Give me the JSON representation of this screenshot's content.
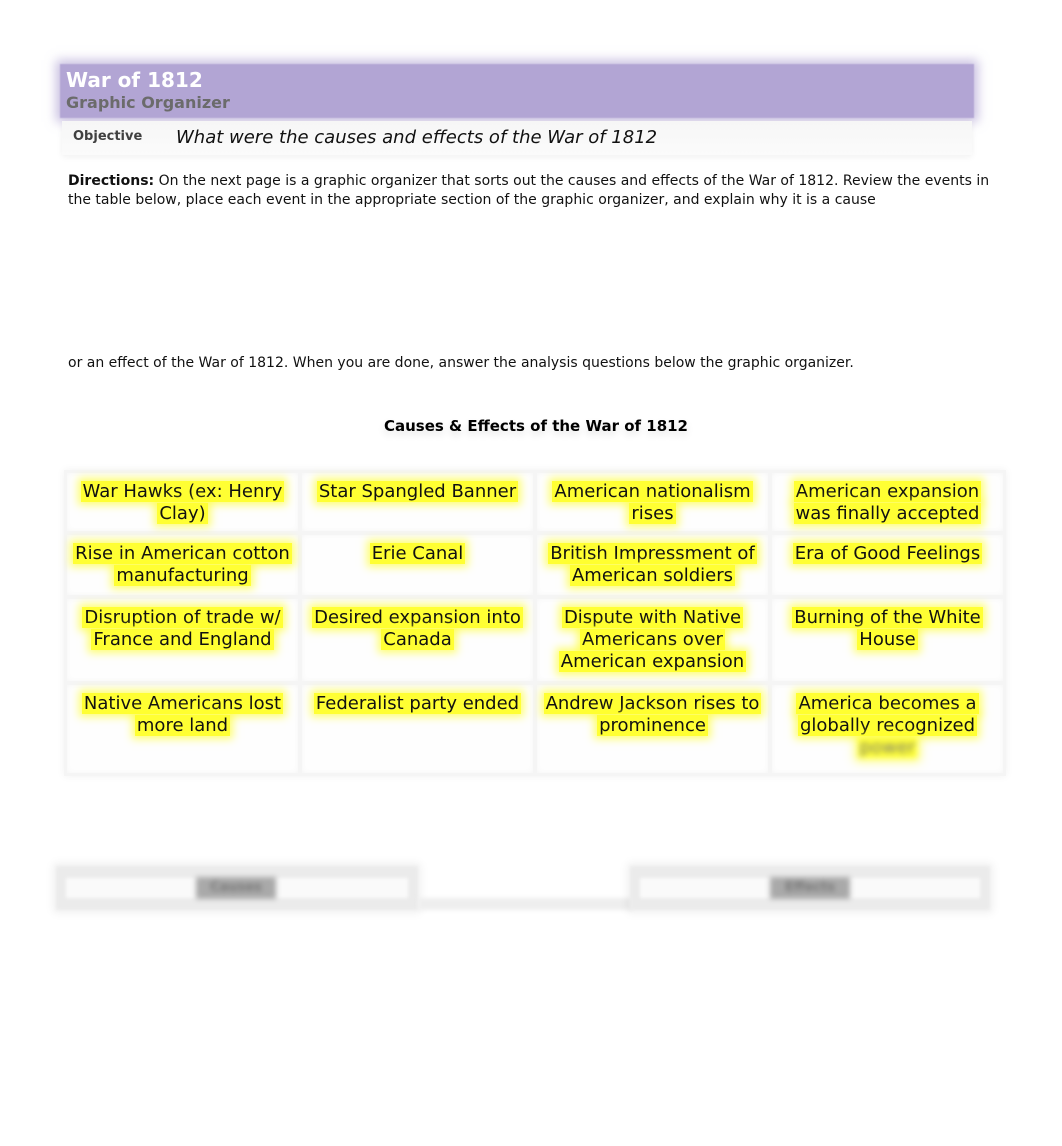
{
  "header": {
    "title": "War of 1812",
    "subtitle": "Graphic Organizer",
    "band_color": "#b2a5d4"
  },
  "objective": {
    "label": "Objective",
    "text": "What were the causes and effects of the War of 1812"
  },
  "directions": {
    "label": "Directions:",
    "text": " On the next page is a graphic organizer that sorts out the causes and effects of the War of 1812. Review the events in the table below, place each event in the appropriate section of the graphic organizer, and explain why it is a cause",
    "continuation": "or an effect of the War of 1812. When you are done, answer the analysis questions below the graphic organizer."
  },
  "events_table": {
    "title": "Causes & Effects of the War of 1812",
    "highlight_color": "#ffff33",
    "rows": [
      [
        "War Hawks (ex: Henry Clay)",
        "Star Spangled Banner",
        "American nationalism rises",
        "American expansion was finally accepted"
      ],
      [
        "Rise in American cotton manufacturing",
        "Erie Canal",
        "British Impressment of American soldiers",
        "Era of Good Feelings"
      ],
      [
        "Disruption of trade w/ France and England",
        "Desired expansion into Canada",
        "Dispute with Native Americans over American expansion",
        "Burning of the White House"
      ],
      [
        "Native Americans lost more land",
        "Federalist party ended",
        "Andrew Jackson rises to prominence",
        "America becomes a globally recognized"
      ]
    ],
    "blurred_tail": "power"
  },
  "organizer": {
    "causes_label": "Causes",
    "effects_label": "Effects"
  }
}
